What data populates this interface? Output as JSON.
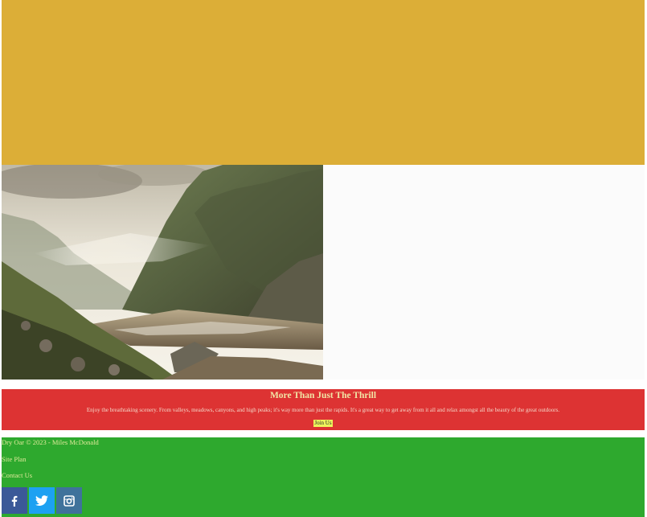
{
  "hero": {},
  "feature": {
    "image_description": "",
    "sky_color": "#f3f1ea"
  },
  "promo": {
    "title": "More Than Just The Thrill",
    "text": "Enjoy the breathtaking scenery. From valleys, meadows, canyons, and high peaks; it's way more than just the rapids. It's a great way to get away from it all and relax amongst all the beauty of the great outdoors.",
    "button_label": "Join Us"
  },
  "footer": {
    "copyright": "Dry Oar © 2023 - Miles McDonald",
    "links": [
      "Site Plan",
      "Contact Us"
    ],
    "social": [
      {
        "icon": "facebook-icon",
        "color": "#3b5998"
      },
      {
        "icon": "twitter-icon",
        "color": "#1da1f2"
      },
      {
        "icon": "instagram-icon",
        "color": "#3f729b"
      }
    ]
  },
  "colors": {
    "hero_bg": "#dcae37",
    "promo_bg": "#dd3333",
    "footer_bg": "#2ea92e",
    "button_bg": "#eef35b"
  }
}
